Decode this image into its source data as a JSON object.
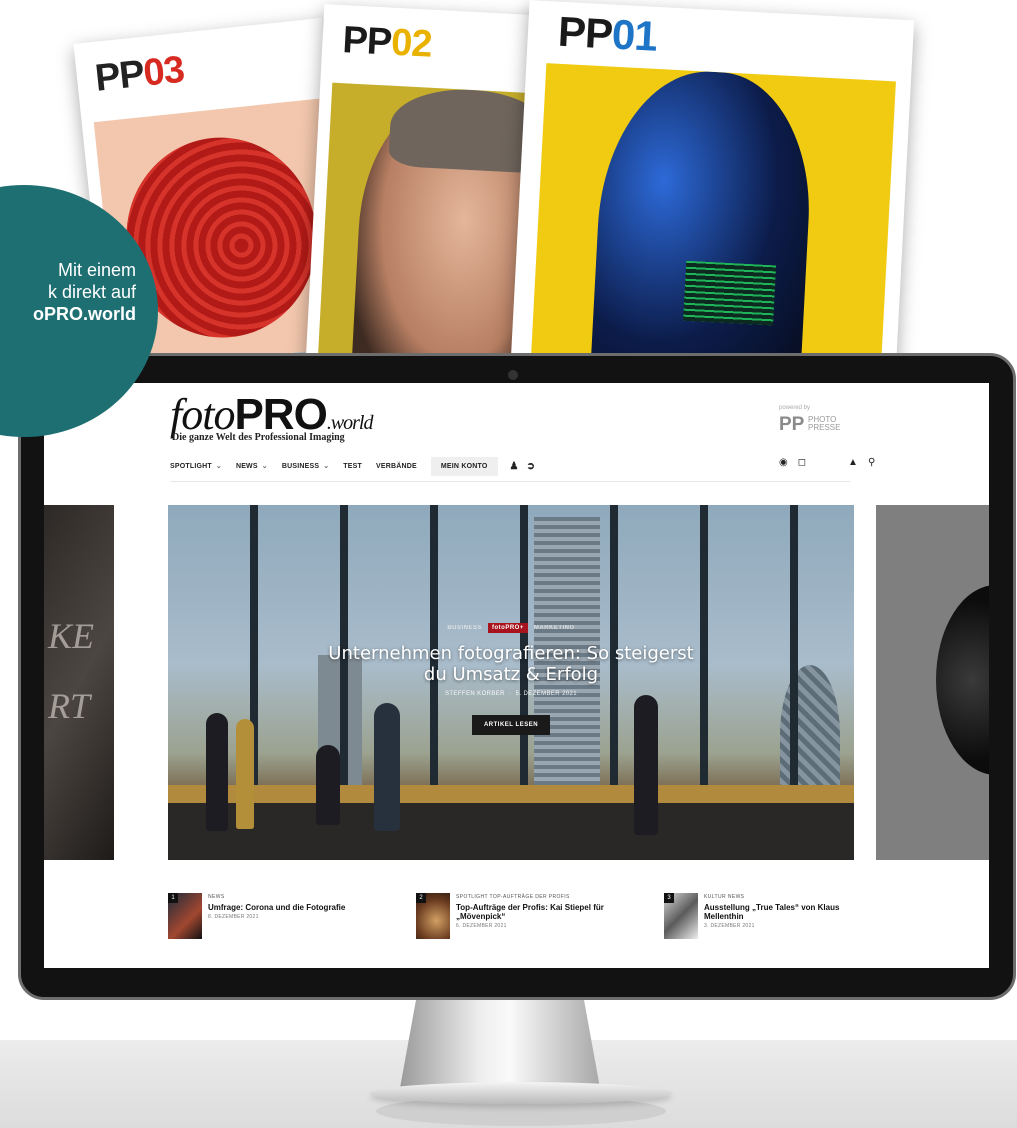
{
  "magazines": [
    {
      "prefix": "PP",
      "number": "03"
    },
    {
      "prefix": "PP",
      "number": "02"
    },
    {
      "prefix": "PP",
      "number": "01"
    }
  ],
  "badge": {
    "line1": "Mit einem",
    "line2": "k direkt auf",
    "line3": "oPRO.world"
  },
  "site": {
    "logo_foto": "foto",
    "logo_pro": "PRO",
    "logo_world": ".world",
    "tagline": "Die ganze Welt des Professional Imaging",
    "powered_by": "powered by",
    "pp_mark": "PP",
    "pp_line1": "PHOTO",
    "pp_line2": "PRESSE"
  },
  "nav": {
    "items": [
      "SPOTLIGHT",
      "NEWS",
      "BUSINESS",
      "TEST",
      "VERBÄNDE"
    ],
    "account": "MEIN KONTO"
  },
  "hero": {
    "tag1": "BUSINESS",
    "tag_plus": "fotoPRO+",
    "tag2": "MARKETING",
    "title_line1": "Unternehmen fotografieren: So steigerst",
    "title_line2": "du Umsatz & Erfolg",
    "author": "STEFFEN KÖRBER",
    "date": "5. DEZEMBER 2021",
    "button": "ARTIKEL LESEN"
  },
  "side_left_text": [
    "KE",
    "RT"
  ],
  "posts": [
    {
      "num": "1",
      "meta": "NEWS",
      "title": "Umfrage: Corona und die Fotografie",
      "date": "8. DEZEMBER 2021"
    },
    {
      "num": "2",
      "meta": "SPOTLIGHT   TOP-AUFTRÄGE DER PROFIS",
      "title": "Top-Aufträge der Profis: Kai Stiepel für „Mövenpick“",
      "date": "6. DEZEMBER 2021"
    },
    {
      "num": "3",
      "meta": "KULTUR   NEWS",
      "title": "Ausstellung „True Tales“ von Klaus Mellenthin",
      "date": "3. DEZEMBER 2021"
    }
  ],
  "colors": {
    "badge_teal": "#1e6f72",
    "plus_red": "#a8141e",
    "pp03_accent": "#d72a20",
    "pp02_accent": "#e9b200",
    "pp01_accent": "#1e74c6"
  }
}
